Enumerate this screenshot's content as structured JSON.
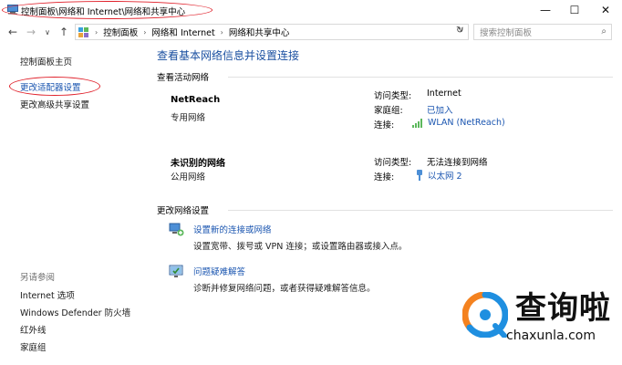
{
  "window": {
    "title": "控制面板\\网络和 Internet\\网络和共享中心",
    "minimize": "—",
    "maximize": "☐",
    "close": "✕"
  },
  "nav": {
    "back": "←",
    "forward": "→",
    "dropdown": "∨",
    "up": "↑",
    "breadcrumbs": [
      "控制面板",
      "网络和 Internet",
      "网络和共享中心"
    ],
    "sep": "›",
    "address_dropdown": "∨",
    "refresh": "↻",
    "search_placeholder": "搜索控制面板",
    "search_icon": "⌕"
  },
  "sidebar": {
    "home": "控制面板主页",
    "change_adapter": "更改适配器设置",
    "change_advanced": "更改高级共享设置",
    "see_also": "另请参阅",
    "links": [
      "Internet 选项",
      "Windows Defender 防火墙",
      "红外线",
      "家庭组"
    ]
  },
  "main": {
    "heading": "查看基本网络信息并设置连接",
    "active_section": "查看活动网络",
    "networks": [
      {
        "name": "NetReach",
        "type": "专用网络",
        "access_label": "访问类型:",
        "access_value": "Internet",
        "homegroup_label": "家庭组:",
        "homegroup_value": "已加入",
        "conn_label": "连接:",
        "conn_value": "WLAN (NetReach)"
      },
      {
        "name": "未识别的网络",
        "type": "公用网络",
        "access_label": "访问类型:",
        "access_value": "无法连接到网络",
        "conn_label": "连接:",
        "conn_value": "以太网 2"
      }
    ],
    "change_section": "更改网络设置",
    "tasks": [
      {
        "link": "设置新的连接或网络",
        "desc": "设置宽带、拨号或 VPN 连接；或设置路由器或接入点。"
      },
      {
        "link": "问题疑难解答",
        "desc": "诊断并修复网络问题，或者获得疑难解答信息。"
      }
    ]
  },
  "watermark": {
    "brand": "查询啦",
    "url": "chaxunla.com"
  },
  "colors": {
    "link": "#1a55b0",
    "heading": "#1a4fa0",
    "annotation": "#e0202a",
    "watermark_orange": "#f4821f",
    "watermark_blue": "#1f8fe0"
  }
}
